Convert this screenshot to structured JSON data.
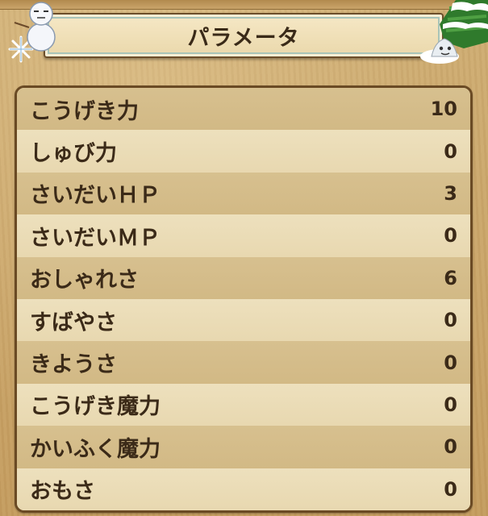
{
  "header": {
    "title": "パラメータ"
  },
  "decorations": {
    "left": "snowman-icon",
    "right": "tree-slime-icon"
  },
  "stats": [
    {
      "label": "こうげき力",
      "value": "10"
    },
    {
      "label": "しゅび力",
      "value": "0"
    },
    {
      "label": "さいだいＨＰ",
      "value": "3"
    },
    {
      "label": "さいだいＭＰ",
      "value": "0"
    },
    {
      "label": "おしゃれさ",
      "value": "6"
    },
    {
      "label": "すばやさ",
      "value": "0"
    },
    {
      "label": "きようさ",
      "value": "0"
    },
    {
      "label": "こうげき魔力",
      "value": "0"
    },
    {
      "label": "かいふく魔力",
      "value": "0"
    },
    {
      "label": "おもさ",
      "value": "0"
    }
  ],
  "colors": {
    "background": "#c9a46a",
    "panel_border": "#6a4a24",
    "text": "#3b2a18"
  }
}
